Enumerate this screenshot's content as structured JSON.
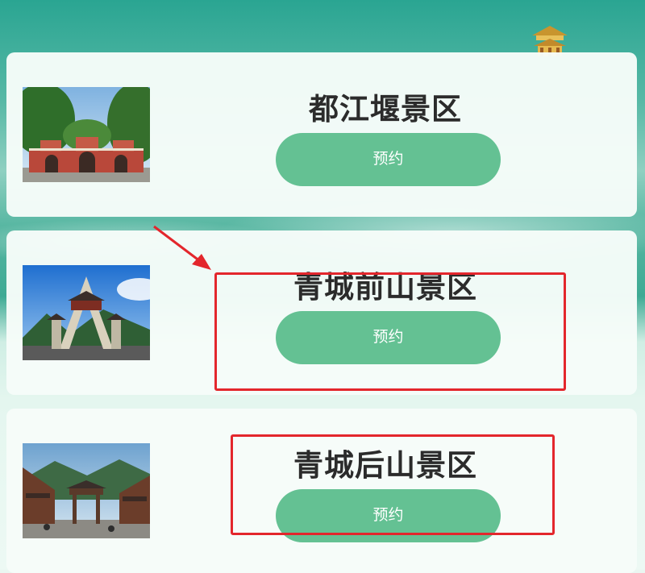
{
  "cards": [
    {
      "title": "都江堰景区",
      "button_label": "预约",
      "image_icon": "dujiangyan-gate-photo"
    },
    {
      "title": "青城前山景区",
      "button_label": "预约",
      "image_icon": "qingcheng-front-gate-photo"
    },
    {
      "title": "青城后山景区",
      "button_label": "预约",
      "image_icon": "qingcheng-back-street-photo"
    }
  ],
  "colors": {
    "button": "#64c193",
    "highlight": "#e3262c",
    "title": "#2b2b2b"
  }
}
